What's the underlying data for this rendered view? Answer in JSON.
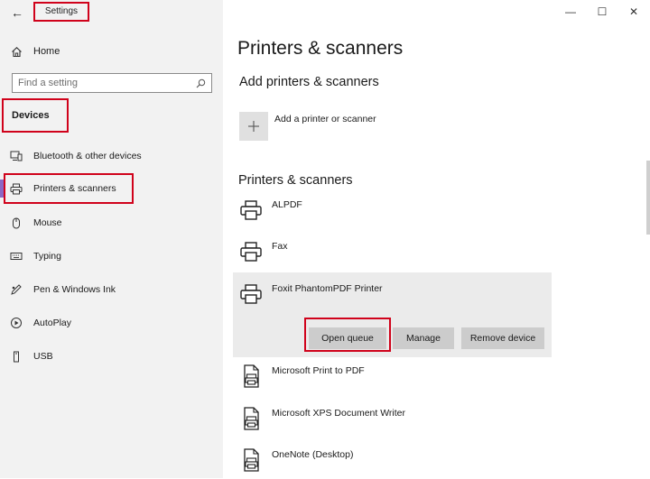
{
  "window": {
    "title": "Settings",
    "controls": {
      "minimize": "—",
      "maximize": "☐",
      "close": "✕"
    }
  },
  "sidebar": {
    "back_glyph": "←",
    "home_label": "Home",
    "search_placeholder": "Find a setting",
    "section_label": "Devices",
    "items": [
      {
        "label": "Bluetooth & other devices",
        "icon": "bluetooth-devices-icon"
      },
      {
        "label": "Printers & scanners",
        "icon": "printer-icon",
        "selected": true
      },
      {
        "label": "Mouse",
        "icon": "mouse-icon"
      },
      {
        "label": "Typing",
        "icon": "keyboard-icon"
      },
      {
        "label": "Pen & Windows Ink",
        "icon": "pen-icon"
      },
      {
        "label": "AutoPlay",
        "icon": "autoplay-icon"
      },
      {
        "label": "USB",
        "icon": "usb-icon"
      }
    ]
  },
  "main": {
    "title": "Printers & scanners",
    "add_section_title": "Add printers & scanners",
    "add_label": "Add a printer or scanner",
    "list_title": "Printers & scanners",
    "printers": [
      {
        "name": "ALPDF",
        "icon": "printer-icon"
      },
      {
        "name": "Fax",
        "icon": "printer-icon"
      },
      {
        "name": "Foxit PhantomPDF Printer",
        "icon": "printer-icon",
        "expanded": true
      },
      {
        "name": "Microsoft Print to PDF",
        "icon": "pdf-printer-icon"
      },
      {
        "name": "Microsoft XPS Document Writer",
        "icon": "pdf-printer-icon"
      },
      {
        "name": "OneNote (Desktop)",
        "icon": "pdf-printer-icon"
      }
    ],
    "actions": {
      "open_queue": "Open queue",
      "manage": "Manage",
      "remove_device": "Remove device"
    }
  },
  "colors": {
    "highlight": "#d0021b",
    "accent": "#8b67c4",
    "sidebar_bg": "#f2f2f2",
    "button_bg": "#cccccc",
    "panel_bg": "#ebebeb"
  }
}
